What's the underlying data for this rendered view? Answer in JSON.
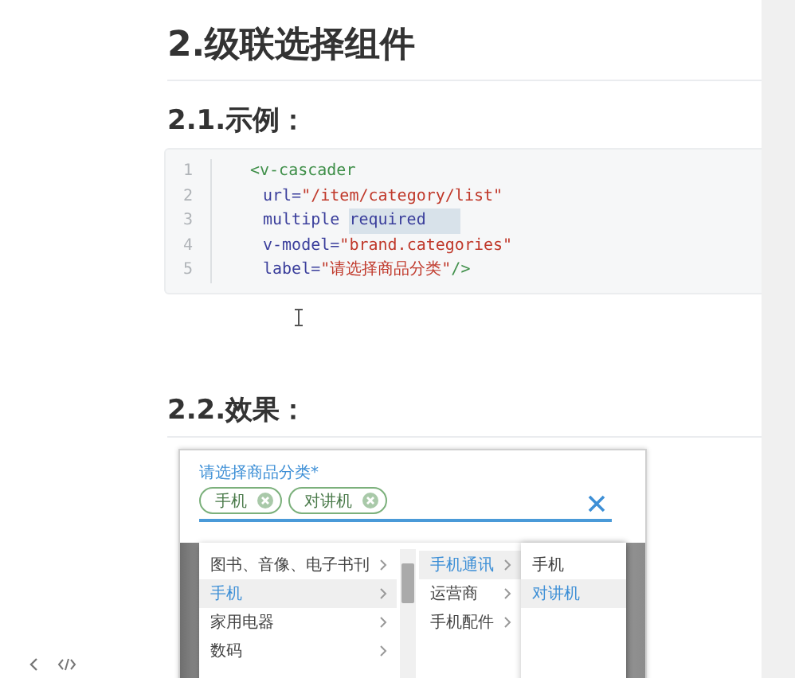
{
  "heading": "2.级联选择组件",
  "example_heading": "2.1.示例：",
  "code": [
    {
      "number": "1",
      "tokens": [
        {
          "kind": "tag",
          "text": "<v-cascader",
          "selected": false
        }
      ]
    },
    {
      "number": "2",
      "tokens": [
        {
          "kind": "attr",
          "text": "url=",
          "selected": false
        },
        {
          "kind": "string",
          "text": "\"/item/category/list\"",
          "selected": false
        }
      ]
    },
    {
      "number": "3",
      "tokens": [
        {
          "kind": "attr",
          "text": "multiple ",
          "selected": false
        },
        {
          "kind": "attr",
          "text": "required",
          "selected": true
        }
      ]
    },
    {
      "number": "4",
      "tokens": [
        {
          "kind": "attr",
          "text": "v-model=",
          "selected": false
        },
        {
          "kind": "string",
          "text": "\"brand.categories\"",
          "selected": false
        }
      ]
    },
    {
      "number": "5",
      "tokens": [
        {
          "kind": "attr",
          "text": "label=",
          "selected": false
        },
        {
          "kind": "string",
          "text": "\"请选择商品分类\"",
          "selected": false
        },
        {
          "kind": "tag",
          "text": "/>",
          "selected": false
        }
      ]
    }
  ],
  "result_heading": "2.2.效果：",
  "demo": {
    "label": "请选择商品分类*",
    "chips": [
      "手机",
      "对讲机"
    ],
    "menu": [
      [
        {
          "label": "图书、音像、电子书刊",
          "has_children": true,
          "selected": false
        },
        {
          "label": "手机",
          "has_children": true,
          "selected": true
        },
        {
          "label": "家用电器",
          "has_children": true,
          "selected": false
        },
        {
          "label": "数码",
          "has_children": true,
          "selected": false
        }
      ],
      [
        {
          "label": "手机通讯",
          "has_children": true,
          "selected": true
        },
        {
          "label": "运营商",
          "has_children": true,
          "selected": false
        },
        {
          "label": "手机配件",
          "has_children": true,
          "selected": false
        }
      ],
      [
        {
          "label": "手机",
          "has_children": false,
          "selected": false
        },
        {
          "label": "对讲机",
          "has_children": false,
          "selected": true
        }
      ]
    ]
  }
}
